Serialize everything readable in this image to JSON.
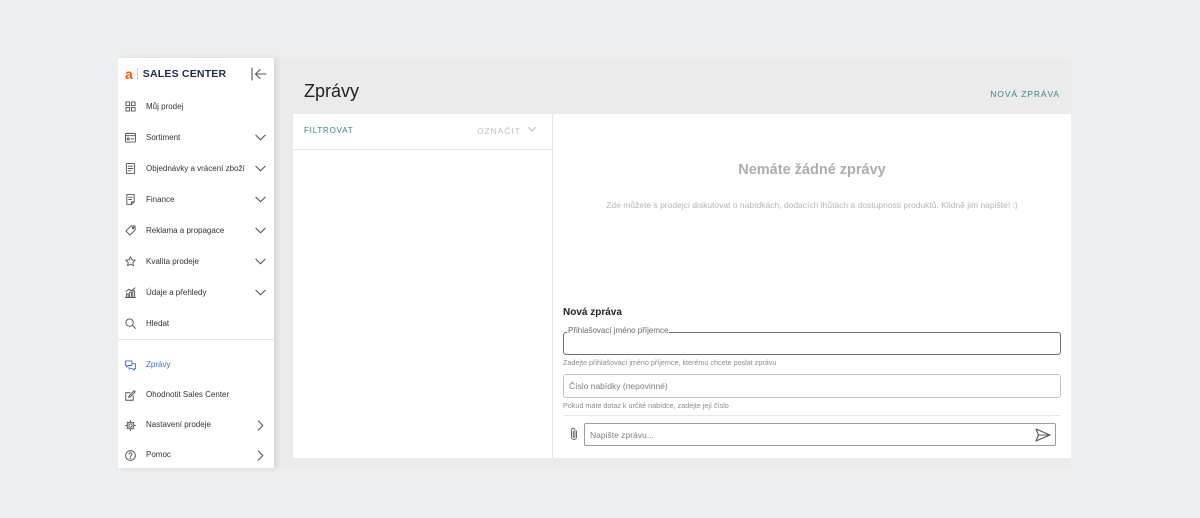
{
  "sidebar": {
    "logo": {
      "letter": "a",
      "text": "SALES CENTER"
    },
    "collapse_icon": "collapse-left-icon",
    "items": [
      {
        "label": "Můj prodej",
        "icon": "grid-icon"
      },
      {
        "label": "Sortiment",
        "icon": "inventory-icon",
        "chevron": "chevron-down-icon"
      },
      {
        "label": "Objednávky a vrácení zboží",
        "icon": "orders-document-icon",
        "chevron": "chevron-down-icon"
      },
      {
        "label": "Finance",
        "icon": "receipt-icon",
        "chevron": "chevron-down-icon"
      },
      {
        "label": "Reklama a propagace",
        "icon": "tag-icon",
        "chevron": "chevron-down-icon"
      },
      {
        "label": "Kvalita prodeje",
        "icon": "star-icon",
        "chevron": "chevron-down-icon"
      },
      {
        "label": "Údaje a přehledy",
        "icon": "chart-icon",
        "chevron": "chevron-down-icon"
      },
      {
        "label": "Hledat",
        "icon": "search-icon"
      }
    ],
    "bottom_items": [
      {
        "label": "Zprávy",
        "icon": "chat-icon",
        "active": true
      },
      {
        "label": "Ohodnotit Sales Center",
        "icon": "edit-icon"
      },
      {
        "label": "Nastavení prodeje",
        "icon": "gear-icon",
        "chevron": "chevron-right-icon"
      },
      {
        "label": "Pomoc",
        "icon": "help-circle-icon",
        "chevron": "chevron-right-icon"
      }
    ]
  },
  "header": {
    "title": "Zprávy",
    "new_message_button": "NOVÁ ZPRÁVA"
  },
  "conversation_list": {
    "filter_label": "FILTROVAT",
    "mark_label": "OZNAČIT",
    "mark_icon": "chevron-down-icon"
  },
  "empty_state": {
    "title": "Nemáte žádné zprávy",
    "text": "Zde můžete s prodejci diskutovat o nabídkách, dodacích lhůtách a dostupnosti produktů. Klidně jim napište! :)"
  },
  "compose": {
    "title": "Nová zpráva",
    "recipient": {
      "label": "Přihlašovací jméno příjemce",
      "value": "",
      "helper": "Zadejte přihlašovací jméno příjemce, kterému chcete poslat zprávu"
    },
    "offer": {
      "placeholder": "Číslo nabídky (nepovinné)",
      "value": "",
      "helper": "Pokud máte dotaz k určité nabídce, zadejte její číslo"
    },
    "message": {
      "placeholder": "Napište zprávu...",
      "value": ""
    },
    "attach_icon": "paperclip-icon",
    "send_icon": "send-icon"
  },
  "colors": {
    "logo_accent": "#ff5a00",
    "brand_navy": "#1b2a4e",
    "teal_accent": "#2e8a84",
    "active_blue": "#3d6fd6",
    "page_background": "#eceef0"
  }
}
